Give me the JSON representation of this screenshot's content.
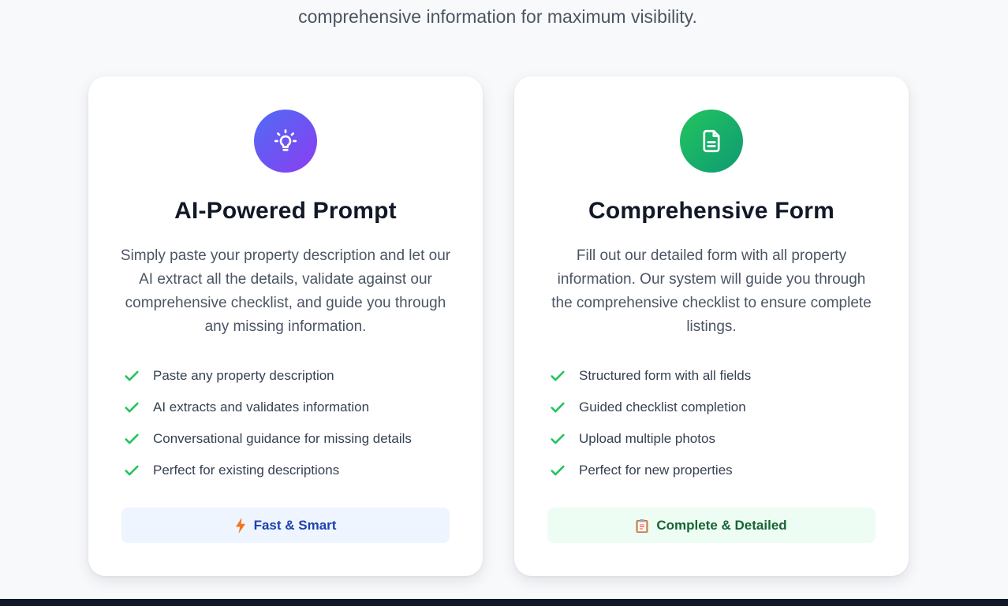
{
  "intro": {
    "line": "comprehensive information for maximum visibility."
  },
  "cards": [
    {
      "icon": "lightbulb-icon",
      "title": "AI-Powered Prompt",
      "description": "Simply paste your property description and let our AI extract all the details, validate against our comprehensive checklist, and guide you through any missing information.",
      "features": [
        "Paste any property description",
        "AI extracts and validates information",
        "Conversational guidance for missing details",
        "Perfect for existing descriptions"
      ],
      "badge": {
        "icon": "lightning-bolt-icon",
        "label": "Fast & Smart"
      }
    },
    {
      "icon": "document-icon",
      "title": "Comprehensive Form",
      "description": "Fill out our detailed form with all property information. Our system will guide you through the comprehensive checklist to ensure complete listings.",
      "features": [
        "Structured form with all fields",
        "Guided checklist completion",
        "Upload multiple photos",
        "Perfect for new properties"
      ],
      "badge": {
        "icon": "clipboard-icon",
        "label": "Complete & Detailed"
      }
    }
  ],
  "colors": {
    "check": "#22c55e",
    "purple_start": "#4f6cf5",
    "purple_end": "#8b3df0",
    "green_start": "#22c55e",
    "green_end": "#0f9a74"
  }
}
